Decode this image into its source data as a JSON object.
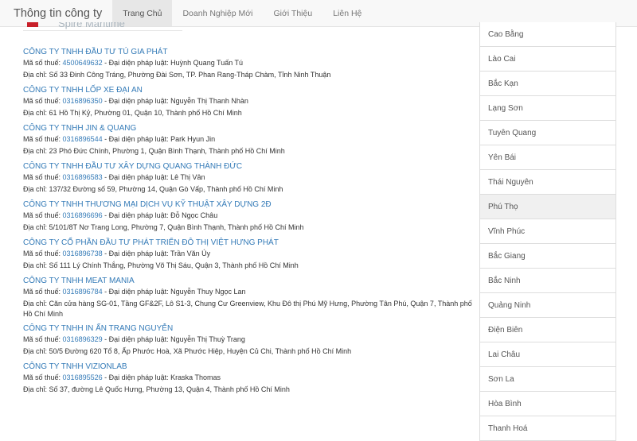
{
  "navbar": {
    "brand": "Thông tin công ty",
    "items": [
      {
        "label": "Trang Chủ",
        "active": true
      },
      {
        "label": "Doanh Nghiệp Mới",
        "active": false
      },
      {
        "label": "Giới Thiệu",
        "active": false
      },
      {
        "label": "Liên Hệ",
        "active": false
      }
    ]
  },
  "logo_partial_text": "Spire Maritime",
  "companies": [
    {
      "name": "CÔNG TY TNHH ĐẦU TƯ TÚ GIA PHÁT",
      "tax_label": "Mã số thuế:",
      "tax": "4500649632",
      "rep": " - Đại diện pháp luật: Huỳnh Quang Tuấn Tú",
      "address": "Địa chỉ: Số 33 Đinh Công Tráng, Phường Đài Sơn, TP. Phan Rang-Tháp Chàm, Tỉnh Ninh Thuận"
    },
    {
      "name": "CÔNG TY TNHH LỐP XE ĐẠI AN",
      "tax_label": "Mã số thuế:",
      "tax": "0316896350",
      "rep": " - Đại diện pháp luật: Nguyễn Thị Thanh Nhàn",
      "address": "Địa chỉ: 61 Hồ Thị Kỷ, Phường 01, Quận 10, Thành phố Hồ Chí Minh"
    },
    {
      "name": "CÔNG TY TNHH JIN & QUANG",
      "tax_label": "Mã số thuế:",
      "tax": "0316896544",
      "rep": " - Đại diện pháp luật: Park Hyun Jin",
      "address": "Địa chỉ: 23 Phó Đức Chính, Phường 1, Quận Bình Thạnh, Thành phố Hồ Chí Minh"
    },
    {
      "name": "CÔNG TY TNHH ĐẦU TƯ XÂY DỰNG QUANG THÀNH ĐỨC",
      "tax_label": "Mã số thuế:",
      "tax": "0316896583",
      "rep": " - Đại diện pháp luật: Lê Thị Vân",
      "address": "Địa chỉ: 137/32 Đường số 59, Phường 14, Quận Gò Vấp, Thành phố Hồ Chí Minh"
    },
    {
      "name": "CÔNG TY TNHH THƯƠNG MẠI DỊCH VỤ KỸ THUẬT XÂY DỰNG 2Đ",
      "tax_label": "Mã số thuế:",
      "tax": "0316896696",
      "rep": " - Đại diện pháp luật: Đỗ Ngọc Châu",
      "address": "Địa chỉ: 5/101/8T Nơ Trang Long, Phường 7, Quận Bình Thạnh, Thành phố Hồ Chí Minh"
    },
    {
      "name": "CÔNG TY CỔ PHẦN ĐẦU TƯ PHÁT TRIỂN ĐÔ THỊ VIỆT HƯNG PHÁT",
      "tax_label": "Mã số thuế:",
      "tax": "0316896738",
      "rep": " - Đại diện pháp luật: Trần Văn Úy",
      "address": "Địa chỉ: Số 111 Lý Chính Thắng, Phường Võ Thị Sáu, Quận 3, Thành phố Hồ Chí Minh"
    },
    {
      "name": "CÔNG TY TNHH MEAT MANIA",
      "tax_label": "Mã số thuế:",
      "tax": "0316896784",
      "rep": " - Đại diện pháp luật: Nguyễn Thuy Ngọc Lan",
      "address": "Địa chỉ: Căn cửa hàng SG-01, Tầng GF&2F, Lô S1-3, Chung Cư Greenview, Khu Đô thị Phú Mỹ Hưng, Phường Tân Phú, Quận 7, Thành phố Hồ Chí Minh"
    },
    {
      "name": "CÔNG TY TNHH IN ẤN TRANG NGUYỄN",
      "tax_label": "Mã số thuế:",
      "tax": "0316896329",
      "rep": " - Đại diện pháp luật: Nguyễn Thị Thuỳ Trang",
      "address": "Địa chỉ: 50/5 Đường 620 Tổ 8, Ấp Phước Hoà, Xã Phước Hiệp, Huyện Củ Chi, Thành phố Hồ Chí Minh"
    },
    {
      "name": "CÔNG TY TNHH VIZIONLAB",
      "tax_label": "Mã số thuế:",
      "tax": "0316895526",
      "rep": " - Đại diện pháp luật: Kraska Thomas",
      "address": "Địa chỉ: Số 37, đường Lê Quốc Hưng, Phường 13, Quận 4, Thành phố Hồ Chí Minh"
    }
  ],
  "provinces": [
    {
      "label": "Cao Bằng",
      "active": false
    },
    {
      "label": "Lào Cai",
      "active": false
    },
    {
      "label": "Bắc Kạn",
      "active": false
    },
    {
      "label": "Lạng Sơn",
      "active": false
    },
    {
      "label": "Tuyên Quang",
      "active": false
    },
    {
      "label": "Yên Bái",
      "active": false
    },
    {
      "label": "Thái Nguyên",
      "active": false
    },
    {
      "label": "Phú Thọ",
      "active": true
    },
    {
      "label": "Vĩnh Phúc",
      "active": false
    },
    {
      "label": "Bắc Giang",
      "active": false
    },
    {
      "label": "Bắc Ninh",
      "active": false
    },
    {
      "label": "Quảng Ninh",
      "active": false
    },
    {
      "label": "Điện Biên",
      "active": false
    },
    {
      "label": "Lai Châu",
      "active": false
    },
    {
      "label": "Sơn La",
      "active": false
    },
    {
      "label": "Hòa Bình",
      "active": false
    },
    {
      "label": "Thanh Hoá",
      "active": false
    }
  ]
}
